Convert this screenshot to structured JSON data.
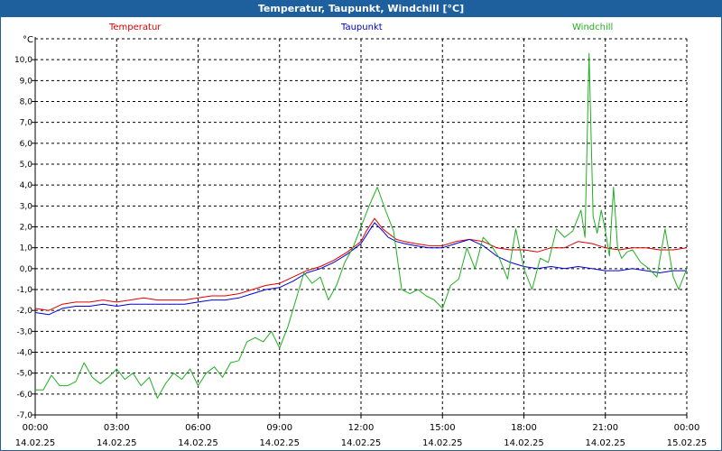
{
  "window": {
    "title": "Temperatur, Taupunkt, Windchill [°C]"
  },
  "chart_data": {
    "type": "line",
    "title": "Temperatur, Taupunkt, Windchill [°C]",
    "ylabel": "°C",
    "ylim": [
      -7,
      11
    ],
    "yticks": [
      "-7,0",
      "-6,0",
      "-5,0",
      "-4,0",
      "-3,0",
      "-2,0",
      "-1,0",
      "0,0",
      "1,0",
      "2,0",
      "3,0",
      "4,0",
      "5,0",
      "6,0",
      "7,0",
      "8,0",
      "9,0",
      "10,0"
    ],
    "xlim": [
      0,
      24
    ],
    "xticks": [
      {
        "time": "00:00",
        "date": "14.02.25"
      },
      {
        "time": "03:00",
        "date": "14.02.25"
      },
      {
        "time": "06:00",
        "date": "14.02.25"
      },
      {
        "time": "09:00",
        "date": "14.02.25"
      },
      {
        "time": "12:00",
        "date": "14.02.25"
      },
      {
        "time": "15:00",
        "date": "14.02.25"
      },
      {
        "time": "18:00",
        "date": "14.02.25"
      },
      {
        "time": "21:00",
        "date": "14.02.25"
      },
      {
        "time": "00:00",
        "date": "15.02.25"
      }
    ],
    "grid": true,
    "legend_position": "top",
    "series": [
      {
        "name": "Temperatur",
        "color": "#e00000",
        "x": [
          0,
          0.5,
          1,
          1.5,
          2,
          2.5,
          3,
          3.5,
          4,
          4.5,
          5,
          5.5,
          6,
          6.5,
          7,
          7.5,
          8,
          8.5,
          9,
          9.5,
          10,
          10.5,
          11,
          11.5,
          11.8,
          12,
          12.2,
          12.5,
          12.8,
          13,
          13.3,
          13.6,
          14,
          14.5,
          15,
          15.5,
          16,
          16.5,
          17,
          17.5,
          18,
          18.5,
          19,
          19.5,
          20,
          20.5,
          21,
          21.5,
          22,
          22.5,
          23,
          23.5,
          24
        ],
        "y": [
          -1.9,
          -2.0,
          -1.7,
          -1.6,
          -1.6,
          -1.5,
          -1.6,
          -1.5,
          -1.4,
          -1.5,
          -1.5,
          -1.5,
          -1.4,
          -1.3,
          -1.3,
          -1.2,
          -1.0,
          -0.8,
          -0.7,
          -0.4,
          -0.1,
          0.1,
          0.4,
          0.8,
          1.1,
          1.3,
          1.8,
          2.4,
          1.9,
          1.7,
          1.4,
          1.3,
          1.2,
          1.1,
          1.1,
          1.3,
          1.4,
          1.3,
          1.0,
          0.9,
          0.9,
          0.8,
          1.0,
          1.0,
          1.3,
          1.2,
          1.0,
          0.9,
          1.0,
          1.0,
          0.9,
          0.9,
          1.0
        ]
      },
      {
        "name": "Taupunkt",
        "color": "#0000d0",
        "x": [
          0,
          0.5,
          1,
          1.5,
          2,
          2.5,
          3,
          3.5,
          4,
          4.5,
          5,
          5.5,
          6,
          6.5,
          7,
          7.5,
          8,
          8.5,
          9,
          9.5,
          10,
          10.5,
          11,
          11.5,
          11.8,
          12,
          12.2,
          12.5,
          12.8,
          13,
          13.3,
          13.6,
          14,
          14.5,
          15,
          15.5,
          16,
          16.5,
          17,
          17.5,
          18,
          18.5,
          19,
          19.5,
          20,
          20.5,
          21,
          21.5,
          22,
          22.5,
          23,
          23.5,
          24
        ],
        "y": [
          -2.1,
          -2.2,
          -1.9,
          -1.8,
          -1.8,
          -1.7,
          -1.8,
          -1.7,
          -1.7,
          -1.7,
          -1.7,
          -1.7,
          -1.6,
          -1.5,
          -1.5,
          -1.4,
          -1.2,
          -1.0,
          -0.9,
          -0.6,
          -0.2,
          0.0,
          0.3,
          0.7,
          1.0,
          1.2,
          1.6,
          2.2,
          1.8,
          1.5,
          1.3,
          1.2,
          1.1,
          1.0,
          1.0,
          1.2,
          1.4,
          1.1,
          0.6,
          0.3,
          0.1,
          0.0,
          0.1,
          0.0,
          0.1,
          0.0,
          -0.1,
          -0.1,
          0.0,
          -0.1,
          -0.2,
          -0.1,
          -0.1
        ]
      },
      {
        "name": "Windchill",
        "color": "#20b020",
        "x": [
          0,
          0.3,
          0.6,
          0.9,
          1.2,
          1.5,
          1.8,
          2.1,
          2.4,
          2.7,
          3.0,
          3.3,
          3.6,
          3.9,
          4.2,
          4.5,
          4.8,
          5.1,
          5.4,
          5.7,
          6.0,
          6.3,
          6.6,
          6.9,
          7.2,
          7.5,
          7.8,
          8.1,
          8.4,
          8.7,
          9.0,
          9.3,
          9.6,
          9.9,
          10.2,
          10.5,
          10.8,
          11.1,
          11.4,
          11.7,
          12.0,
          12.3,
          12.6,
          12.9,
          13.2,
          13.5,
          13.8,
          14.1,
          14.4,
          14.7,
          15.0,
          15.3,
          15.6,
          15.9,
          16.2,
          16.5,
          16.8,
          17.1,
          17.4,
          17.7,
          18.0,
          18.3,
          18.6,
          18.9,
          19.2,
          19.5,
          19.8,
          20.1,
          20.25,
          20.4,
          20.55,
          20.7,
          20.85,
          21.0,
          21.15,
          21.3,
          21.45,
          21.6,
          21.8,
          22.0,
          22.3,
          22.6,
          22.9,
          23.2,
          23.5,
          23.7,
          24.0
        ],
        "y": [
          -5.8,
          -5.8,
          -5.1,
          -5.6,
          -5.6,
          -5.4,
          -4.5,
          -5.2,
          -5.5,
          -5.2,
          -4.8,
          -5.3,
          -5.0,
          -5.6,
          -5.2,
          -6.2,
          -5.5,
          -5.0,
          -5.3,
          -4.8,
          -5.6,
          -5.0,
          -4.7,
          -5.2,
          -4.5,
          -4.4,
          -3.5,
          -3.3,
          -3.5,
          -3.0,
          -3.8,
          -2.8,
          -1.5,
          -0.2,
          -0.7,
          -0.4,
          -1.5,
          -0.8,
          0.3,
          1.0,
          2.0,
          3.0,
          3.9,
          2.8,
          1.8,
          -1.0,
          -1.2,
          -1.0,
          -1.3,
          -1.5,
          -1.9,
          -0.8,
          -0.5,
          1.0,
          0.0,
          1.5,
          1.1,
          0.5,
          -0.5,
          1.9,
          0.0,
          -1.0,
          0.5,
          0.3,
          1.9,
          1.5,
          1.8,
          2.8,
          1.5,
          10.3,
          2.5,
          1.7,
          2.8,
          1.8,
          0.6,
          3.9,
          1.0,
          0.5,
          0.8,
          0.9,
          0.3,
          0.0,
          -0.4,
          1.9,
          -0.4,
          -1.0,
          0.0
        ]
      }
    ]
  }
}
